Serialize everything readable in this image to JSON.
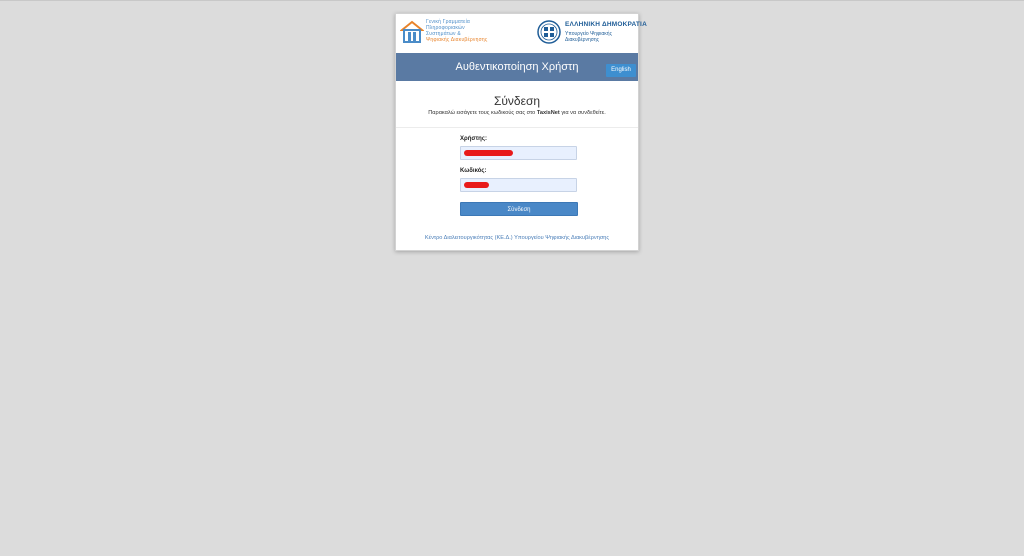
{
  "logos": {
    "left_lines": [
      "Γενική Γραμματεία",
      "Πληροφοριακών",
      "Συστημάτων &",
      "Ψηφιακής Διακυβέρνησης"
    ],
    "right_title": "ΕΛΛΗΝΙΚΗ ΔΗΜΟΚΡΑΤΙΑ",
    "right_sub": [
      "Υπουργείο Ψηφιακής",
      "Διακυβέρνησης"
    ]
  },
  "header": {
    "title": "Αυθεντικοποίηση Χρήστη",
    "lang_button": "English"
  },
  "login": {
    "title": "Σύνδεση",
    "intro_before": "Παρακαλώ εισάγετε τους κωδικούς σας στο",
    "intro_brand": "TaxisNet",
    "intro_after": "για να συνδεθείτε.",
    "username_label": "Χρήστης:",
    "password_label": "Κωδικός:",
    "submit_label": "Σύνδεση"
  },
  "footer": {
    "text": "Κέντρο Διαλειτουργικότητας (ΚΕ.Δ.) Υπουργείου Ψηφιακής Διακυβέρνησης"
  },
  "colors": {
    "header_bg": "#5a7aa3",
    "button_bg": "#4a88c7",
    "redaction": "#e81a1a",
    "page_bg": "#dcdcdc"
  }
}
